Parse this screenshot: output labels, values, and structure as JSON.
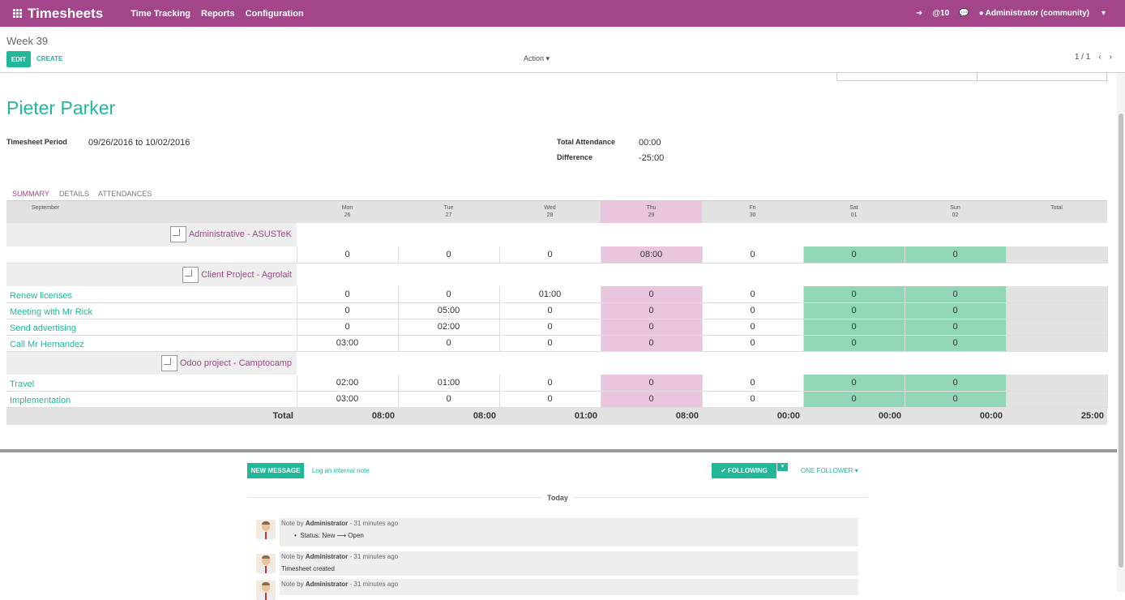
{
  "app": {
    "title": "Timesheets",
    "menu": [
      "Time Tracking",
      "Reports",
      "Configuration"
    ]
  },
  "nav_right": {
    "mentions": "@10",
    "user": "Administrator (community)"
  },
  "control_panel": {
    "breadcrumb": "Week 39",
    "edit": "EDIT",
    "create": "CREATE",
    "action": "Action",
    "pager": "1 / 1"
  },
  "sheet": {
    "employee": "Pieter Parker",
    "period_label": "Timesheet Period",
    "period_value": "09/26/2016 to 10/02/2016",
    "attendance_label": "Total Attendance",
    "attendance_value": "00:00",
    "difference_label": "Difference",
    "difference_value": "-25:00",
    "tabs": [
      "SUMMARY",
      "DETAILS",
      "ATTENDANCES"
    ]
  },
  "grid": {
    "month": "September",
    "days": [
      {
        "d": "Mon",
        "n": "26"
      },
      {
        "d": "Tue",
        "n": "27"
      },
      {
        "d": "Wed",
        "n": "28"
      },
      {
        "d": "Thu",
        "n": "29"
      },
      {
        "d": "Fri",
        "n": "30"
      },
      {
        "d": "Sat",
        "n": "01"
      },
      {
        "d": "Sun",
        "n": "02"
      }
    ],
    "total_header": "Total",
    "projects": [
      {
        "name": "Administrative - ASUSTeK",
        "rows": [
          {
            "task": "",
            "values": [
              "0",
              "0",
              "0",
              "08:00",
              "0",
              "0",
              "0"
            ]
          }
        ]
      },
      {
        "name": "Client Project - Agrolait",
        "rows": [
          {
            "task": "Renew licenses",
            "values": [
              "0",
              "0",
              "01:00",
              "0",
              "0",
              "0",
              "0"
            ]
          },
          {
            "task": "Meeting with Mr Rick",
            "values": [
              "0",
              "05:00",
              "0",
              "0",
              "0",
              "0",
              "0"
            ]
          },
          {
            "task": "Send advertising",
            "values": [
              "0",
              "02:00",
              "0",
              "0",
              "0",
              "0",
              "0"
            ]
          },
          {
            "task": "Call Mr Hernandez",
            "values": [
              "03:00",
              "0",
              "0",
              "0",
              "0",
              "0",
              "0"
            ]
          }
        ]
      },
      {
        "name": "Odoo project - Camptocamp",
        "rows": [
          {
            "task": "Travel",
            "values": [
              "02:00",
              "01:00",
              "0",
              "0",
              "0",
              "0",
              "0"
            ]
          },
          {
            "task": "Implementation",
            "values": [
              "03:00",
              "0",
              "0",
              "0",
              "0",
              "0",
              "0"
            ]
          }
        ]
      }
    ],
    "total_label": "Total",
    "totals": [
      "08:00",
      "08:00",
      "01:00",
      "08:00",
      "00:00",
      "00:00",
      "00:00",
      "25:00"
    ]
  },
  "chatter": {
    "new_message": "NEW MESSAGE",
    "log_note": "Log an internal note",
    "following": "✔ FOLLOWING",
    "followers": "ONE FOLLOWER",
    "day": "Today",
    "messages": [
      {
        "type": "Note by",
        "author": "Administrator",
        "time": "- 31 minutes ago",
        "body": "Status: New ⟶ Open"
      },
      {
        "type": "Note by",
        "author": "Administrator",
        "time": "- 31 minutes ago",
        "body": "Timesheet created"
      },
      {
        "type": "Note by",
        "author": "Administrator",
        "time": "- 31 minutes ago",
        "body": ""
      }
    ]
  }
}
